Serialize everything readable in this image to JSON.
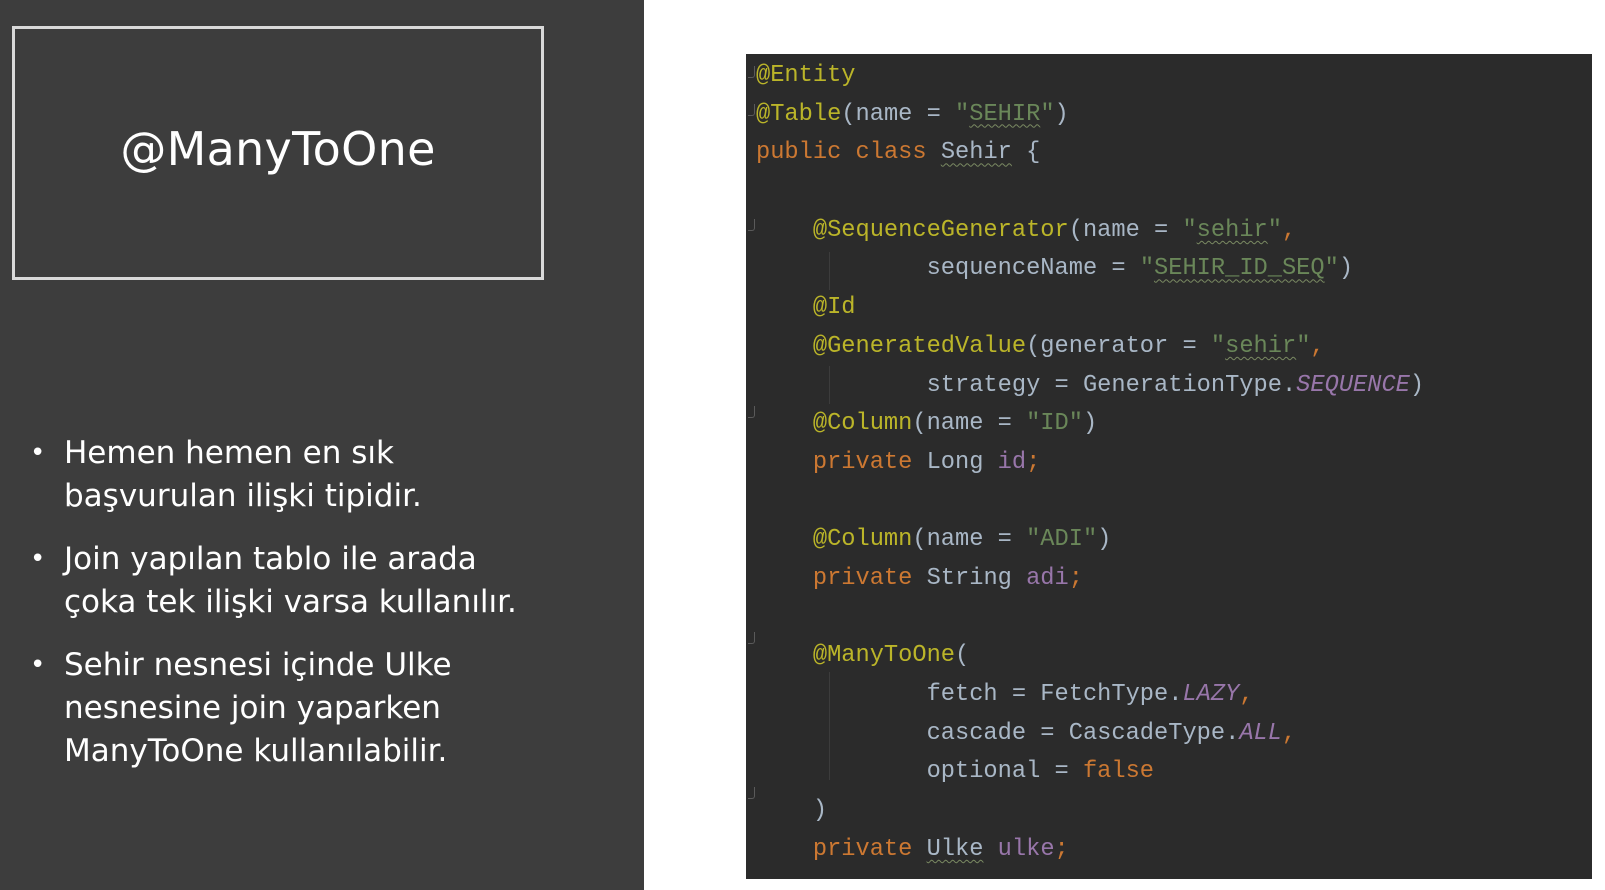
{
  "slide": {
    "title": "@ManyToOne",
    "bullets": [
      {
        "lines": [
          "Hemen hemen en sık",
          "başvurulan ilişki tipidir."
        ]
      },
      {
        "lines": [
          "Join yapılan tablo ile arada",
          "çoka tek ilişki varsa kullanılır."
        ]
      },
      {
        "lines": [
          "Sehir nesnesi içinde Ulke",
          "nesnesine join yaparken",
          "ManyToOne kullanılabilir."
        ]
      }
    ]
  },
  "code": {
    "lines": [
      [
        {
          "t": "@Entity",
          "c": "ann"
        }
      ],
      [
        {
          "t": "@Table",
          "c": "ann"
        },
        {
          "t": "(name = "
        },
        {
          "t": "\"",
          "c": "str"
        },
        {
          "t": "SEHIR",
          "c": "str wavy"
        },
        {
          "t": "\"",
          "c": "str"
        },
        {
          "t": ")"
        }
      ],
      [
        {
          "t": "public",
          "c": "kw"
        },
        {
          "t": " "
        },
        {
          "t": "class",
          "c": "kw"
        },
        {
          "t": " "
        },
        {
          "t": "Sehir",
          "c": "wavy"
        },
        {
          "t": " {"
        }
      ],
      [],
      [
        {
          "t": "    "
        },
        {
          "t": "@SequenceGenerator",
          "c": "ann"
        },
        {
          "t": "(name = "
        },
        {
          "t": "\"",
          "c": "str"
        },
        {
          "t": "sehir",
          "c": "str wavy"
        },
        {
          "t": "\"",
          "c": "str"
        },
        {
          "t": ",",
          "c": "kw"
        }
      ],
      [
        {
          "t": "            sequenceName = "
        },
        {
          "t": "\"",
          "c": "str"
        },
        {
          "t": "SEHIR_ID_SEQ",
          "c": "str wavy"
        },
        {
          "t": "\"",
          "c": "str"
        },
        {
          "t": ")"
        }
      ],
      [
        {
          "t": "    "
        },
        {
          "t": "@Id",
          "c": "ann"
        }
      ],
      [
        {
          "t": "    "
        },
        {
          "t": "@GeneratedValue",
          "c": "ann"
        },
        {
          "t": "(generator = "
        },
        {
          "t": "\"",
          "c": "str"
        },
        {
          "t": "sehir",
          "c": "str wavy"
        },
        {
          "t": "\"",
          "c": "str"
        },
        {
          "t": ",",
          "c": "kw"
        }
      ],
      [
        {
          "t": "            strategy = GenerationType."
        },
        {
          "t": "SEQUENCE",
          "c": "const"
        },
        {
          "t": ")"
        }
      ],
      [
        {
          "t": "    "
        },
        {
          "t": "@Column",
          "c": "ann"
        },
        {
          "t": "(name = "
        },
        {
          "t": "\"ID\"",
          "c": "str"
        },
        {
          "t": ")"
        }
      ],
      [
        {
          "t": "    "
        },
        {
          "t": "private",
          "c": "kw"
        },
        {
          "t": " Long "
        },
        {
          "t": "id",
          "c": "fld"
        },
        {
          "t": ";",
          "c": "kw"
        }
      ],
      [],
      [
        {
          "t": "    "
        },
        {
          "t": "@Column",
          "c": "ann"
        },
        {
          "t": "(name = "
        },
        {
          "t": "\"ADI\"",
          "c": "str"
        },
        {
          "t": ")"
        }
      ],
      [
        {
          "t": "    "
        },
        {
          "t": "private",
          "c": "kw"
        },
        {
          "t": " String "
        },
        {
          "t": "adi",
          "c": "fld"
        },
        {
          "t": ";",
          "c": "kw"
        }
      ],
      [],
      [
        {
          "t": "    "
        },
        {
          "t": "@ManyToOne",
          "c": "ann"
        },
        {
          "t": "("
        }
      ],
      [
        {
          "t": "            fetch = FetchType."
        },
        {
          "t": "LAZY",
          "c": "const"
        },
        {
          "t": ",",
          "c": "kw"
        }
      ],
      [
        {
          "t": "            cascade = CascadeType."
        },
        {
          "t": "ALL",
          "c": "const"
        },
        {
          "t": ",",
          "c": "kw"
        }
      ],
      [
        {
          "t": "            optional = "
        },
        {
          "t": "false",
          "c": "kw"
        }
      ],
      [
        {
          "t": "    )"
        }
      ],
      [
        {
          "t": "    "
        },
        {
          "t": "private",
          "c": "kw"
        },
        {
          "t": " "
        },
        {
          "t": "Ulke",
          "c": "wavy"
        },
        {
          "t": " "
        },
        {
          "t": "ulke",
          "c": "fld"
        },
        {
          "t": ";",
          "c": "kw"
        }
      ]
    ]
  }
}
